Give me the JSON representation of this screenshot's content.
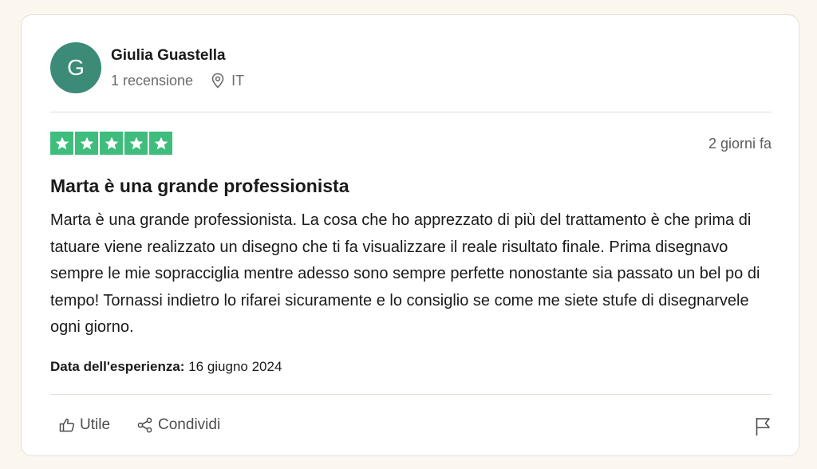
{
  "review": {
    "user": {
      "initial": "G",
      "name": "Giulia Guastella",
      "reviews_count": "1 recensione",
      "country": "IT"
    },
    "rating": 5,
    "max_rating": 5,
    "date": "2 giorni fa",
    "title": "Marta è una grande professionista",
    "body": "Marta è una grande professionista. La cosa che ho apprezzato di più del trattamento è che prima di tatuare viene realizzato un disegno che ti fa visualizzare il reale risultato finale. Prima disegnavo sempre le mie sopracciglia mentre adesso sono sempre perfette nonostante sia passato un bel po di tempo! Tornassi indietro lo rifarei sicuramente e lo consiglio se come me siete stufe di disegnarvele ogni giorno.",
    "experience_label": "Data dell'esperienza:",
    "experience_date": "16 giugno 2024"
  },
  "actions": {
    "useful_label": "Utile",
    "share_label": "Condividi"
  },
  "icons": {
    "location": "location-pin-icon",
    "star": "star-icon",
    "useful": "thumbs-up-icon",
    "share": "share-icon",
    "report": "flag-icon"
  },
  "colors": {
    "avatar_bg": "#3c8a78",
    "star_bg": "#3fbd7d",
    "page_bg": "#fbf7ee",
    "card_bg": "#ffffff"
  }
}
